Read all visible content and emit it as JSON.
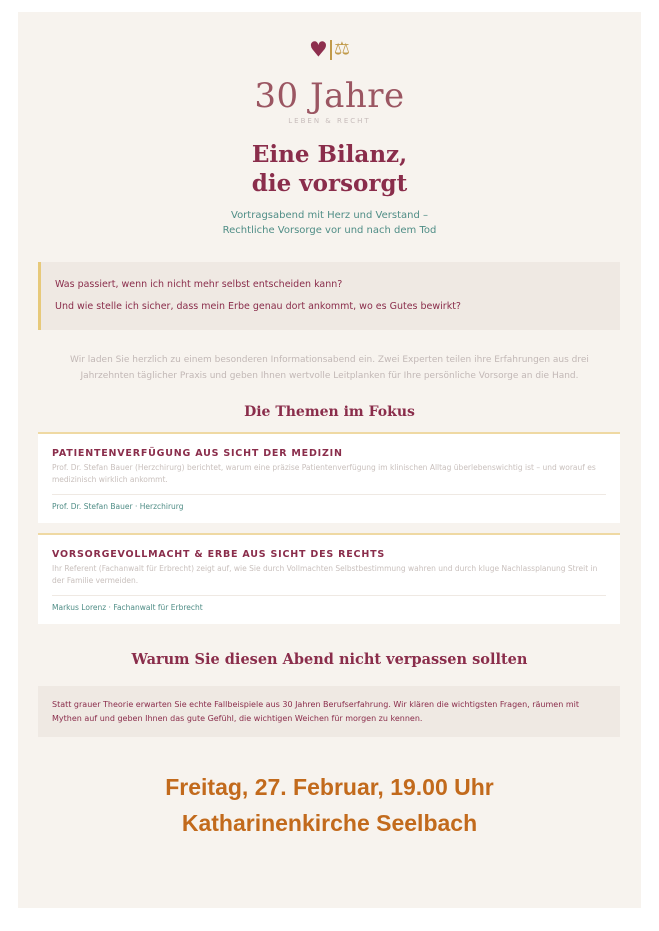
{
  "logo": {
    "heart": "♥",
    "scale": "⚖",
    "heart_color": "#8e2f4e",
    "scale_color": "#c19a4a"
  },
  "header": {
    "title": "30 Jahre",
    "subtitle": "LEBEN & RECHT"
  },
  "heading": {
    "line1": "Eine Bilanz,",
    "line2": "die vorsorgt"
  },
  "tagline": {
    "line1": "Vortragsabend mit Herz und Verstand –",
    "line2": "Rechtliche Vorsorge vor und nach dem Tod"
  },
  "questions": [
    "Was passiert, wenn ich nicht mehr selbst entscheiden kann?",
    "Und wie stelle ich sicher, dass mein Erbe genau dort ankommt, wo es Gutes bewirkt?"
  ],
  "intro": "Wir laden Sie herzlich zu einem besonderen Informationsabend ein. Zwei Experten teilen ihre Erfahrungen aus drei Jahrzehnten täglicher Praxis und geben Ihnen wertvolle Leitplanken für Ihre persönliche Vorsorge an die Hand.",
  "topics_heading": "Die Themen im Fokus",
  "topics": [
    {
      "title": "PATIENTENVERFÜGUNG AUS SICHT DER MEDIZIN",
      "text": "Prof. Dr. Stefan Bauer (Herzchirurg) berichtet, warum eine präzise Patientenverfügung im klinischen Alltag überlebenswichtig ist – und worauf es medizinisch wirklich ankommt.",
      "speaker": "Prof. Dr. Stefan Bauer · Herzchirurg"
    },
    {
      "title": "VORSORGEVOLLMACHT & ERBE AUS SICHT DES RECHTS",
      "text": "Ihr Referent (Fachanwalt für Erbrecht) zeigt auf, wie Sie durch Vollmachten Selbstbestimmung wahren und durch kluge Nachlassplanung Streit in der Familie vermeiden.",
      "speaker": "Markus Lorenz · Fachanwalt für Erbrecht"
    }
  ],
  "why_heading": "Warum Sie diesen Abend nicht verpassen sollten",
  "why_text": "Statt grauer Theorie erwarten Sie echte Fallbeispiele aus 30 Jahren Berufserfahrung. Wir klären die wichtigsten Fragen, räumen mit Mythen auf und geben Ihnen das gute Gefühl, die wichtigen Weichen für morgen zu kennen.",
  "event": {
    "date": "Freitag, 27. Februar, 19.00 Uhr",
    "location": "Katharinenkirche Seelbach"
  },
  "colors": {
    "primary": "#8a2d4b",
    "accent_teal": "#4f8d86",
    "accent_gold": "#c19a4a",
    "event_orange": "#c26a1c",
    "background": "#f7f3ee"
  }
}
